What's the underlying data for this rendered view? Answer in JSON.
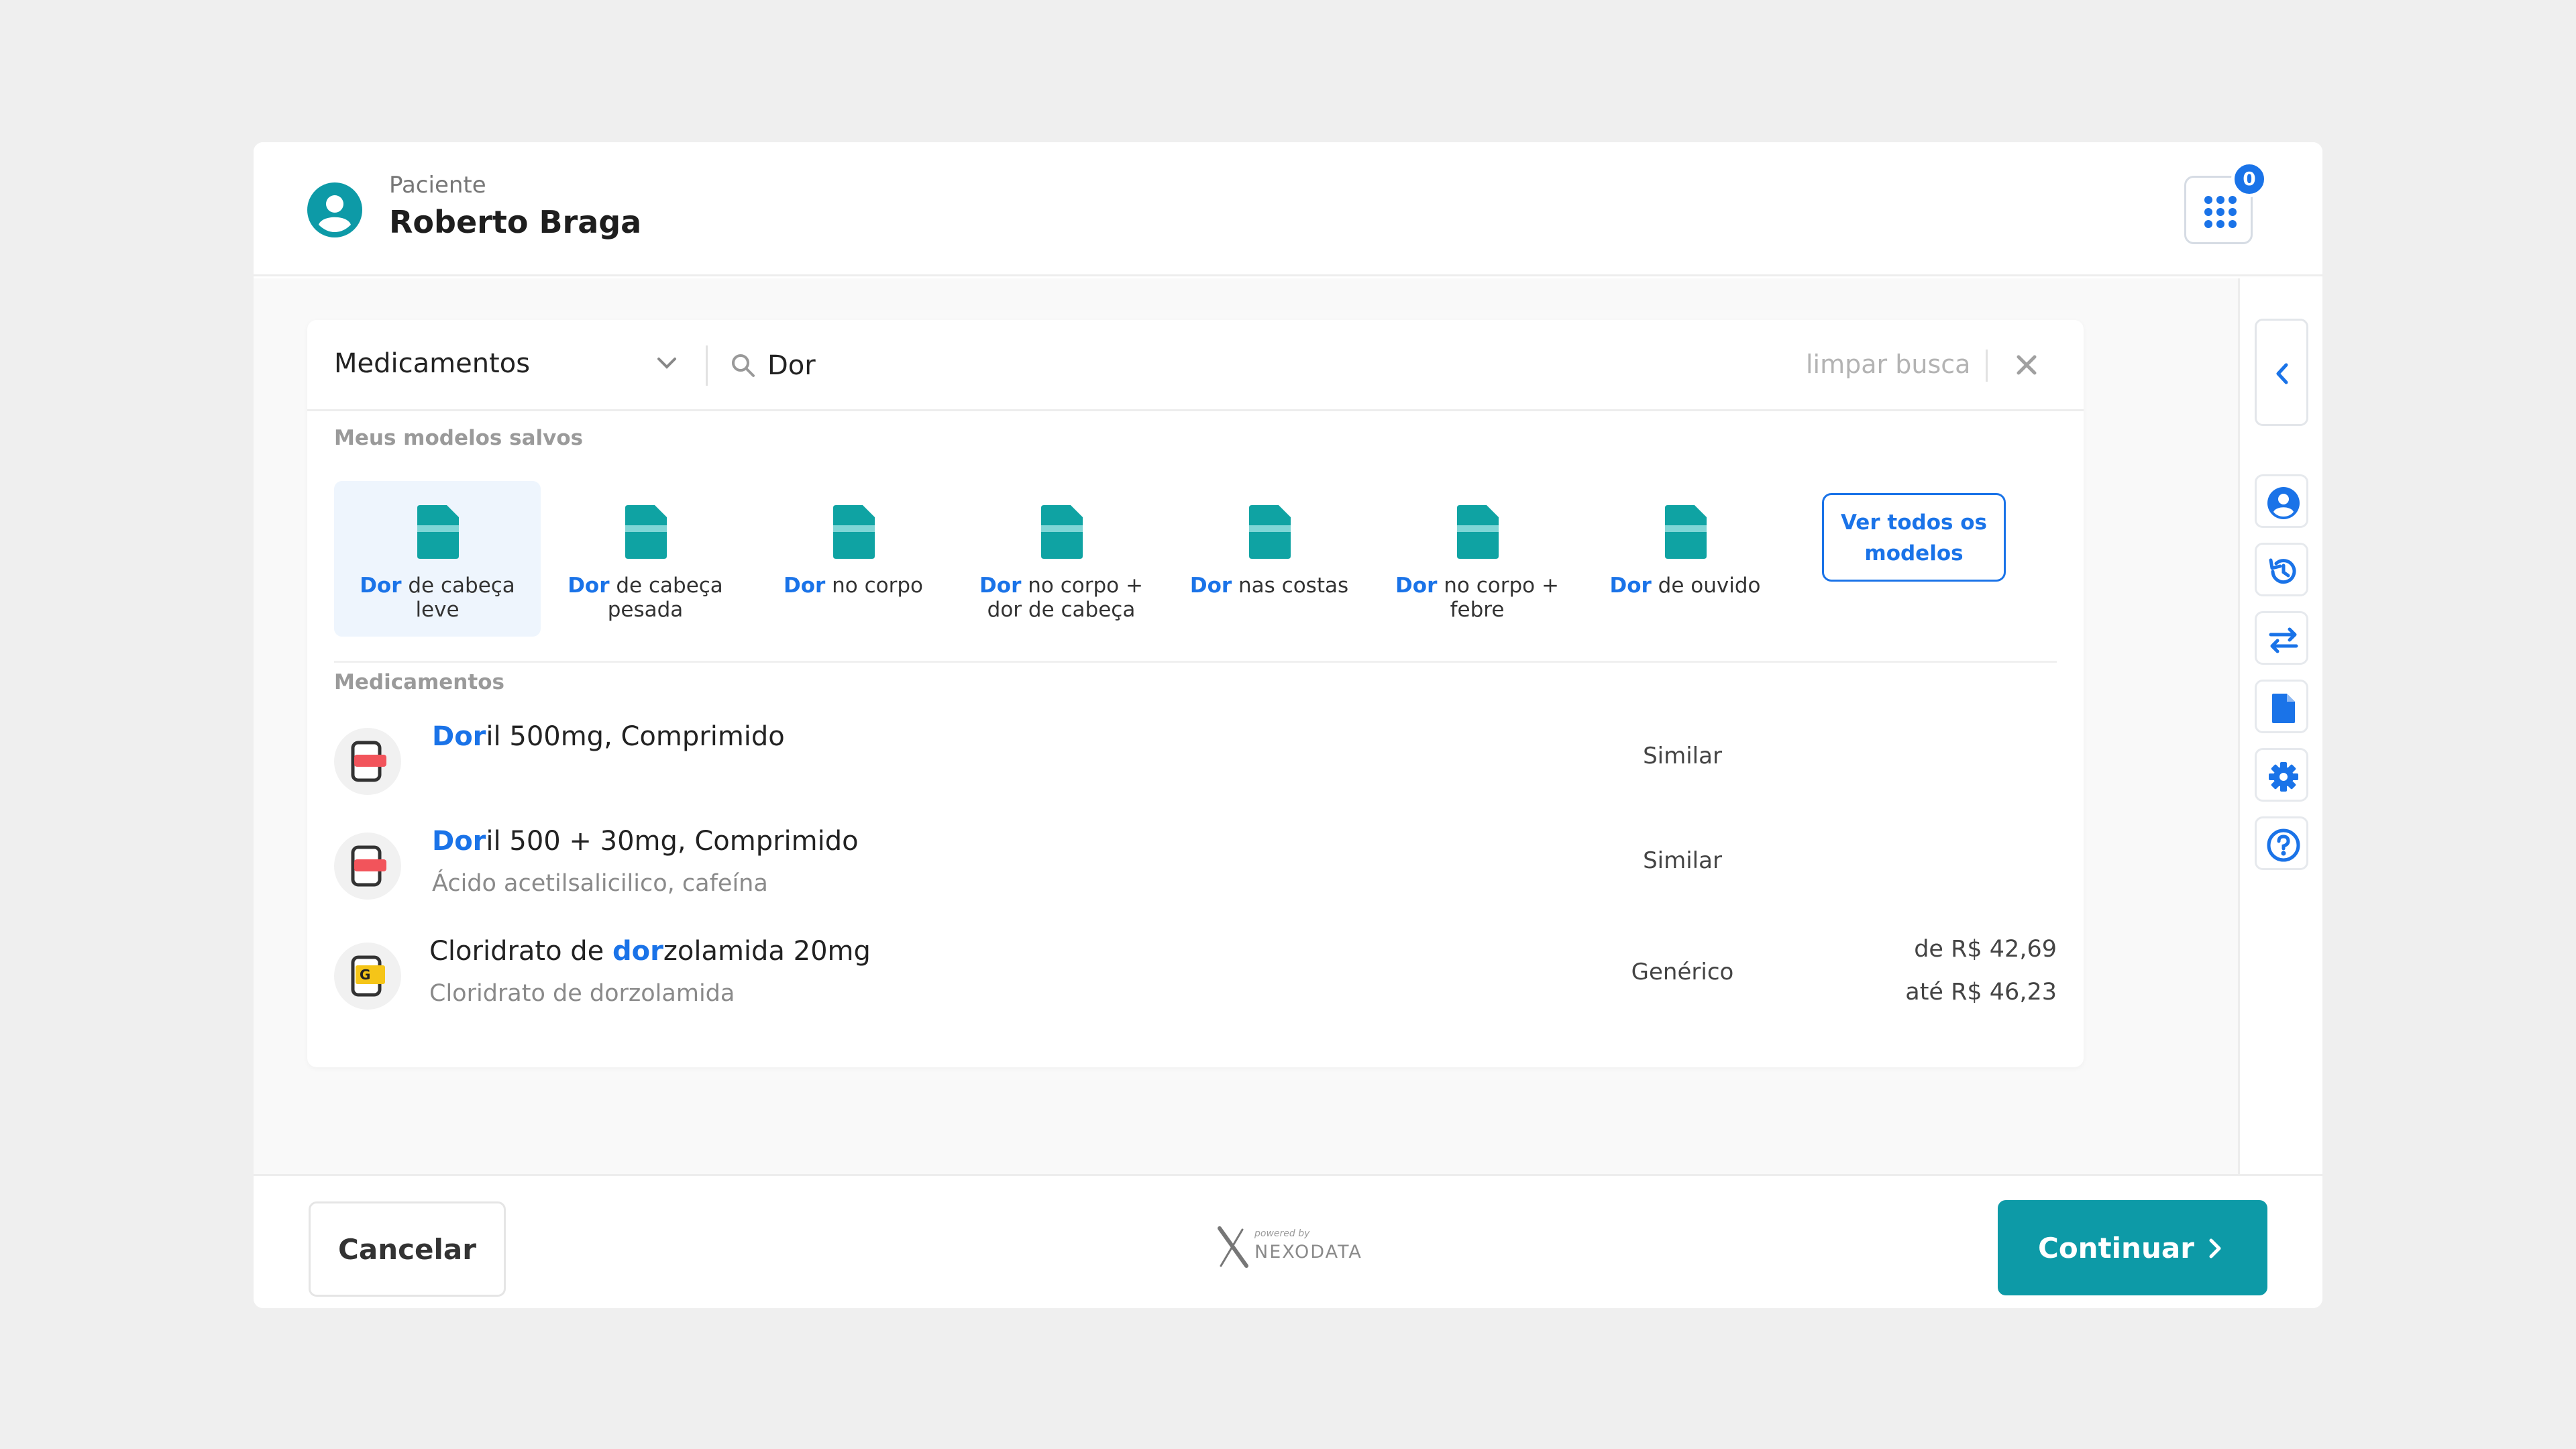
{
  "header": {
    "patient_label": "Paciente",
    "patient_name": "Roberto Braga",
    "apps_badge": "0"
  },
  "search": {
    "category": "Medicamentos",
    "query": "Dor",
    "clear_label": "limpar busca"
  },
  "templates": {
    "section_label": "Meus modelos salvos",
    "items": [
      {
        "highlight": "Dor",
        "line1": " de cabeça",
        "line2": "leve"
      },
      {
        "highlight": "Dor",
        "line1": " de cabeça",
        "line2": "pesada"
      },
      {
        "highlight": "Dor",
        "line1": " no corpo",
        "line2": ""
      },
      {
        "highlight": "Dor",
        "line1": " no corpo +",
        "line2": "dor de cabeça"
      },
      {
        "highlight": "Dor",
        "line1": " nas costas",
        "line2": ""
      },
      {
        "highlight": "Dor",
        "line1": " no corpo +",
        "line2": "febre"
      },
      {
        "highlight": "Dor",
        "line1": " de ouvido",
        "line2": ""
      }
    ],
    "see_all_line1": "Ver todos os",
    "see_all_line2": "modelos"
  },
  "medications": {
    "section_label": "Medicamentos",
    "items": [
      {
        "pre": "",
        "hl": "Dor",
        "post": "il 500mg, Comprimido",
        "sub": "",
        "type": "Similar",
        "price_from": "",
        "price_to": ""
      },
      {
        "pre": "",
        "hl": "Dor",
        "post": "il 500 + 30mg, Comprimido",
        "sub": "Ácido acetilsalicilico, cafeína",
        "type": "Similar",
        "price_from": "",
        "price_to": ""
      },
      {
        "pre": "Cloridrato de ",
        "hl": "dor",
        "post": "zolamida 20mg",
        "sub": "Cloridrato de dorzolamida",
        "type": "Genérico",
        "price_from": "de R$ 42,69",
        "price_to": "até R$ 46,23"
      }
    ]
  },
  "footer": {
    "cancel": "Cancelar",
    "logo_small": "powered by",
    "logo_text": "NEXODATA",
    "continue": "Continuar"
  },
  "colors": {
    "accent_blue": "#1a73e8",
    "primary_teal": "#0d9aa7",
    "template_icon": "#0fa3a3",
    "similar_pill": "#f2545b",
    "generic_badge": "#f5c518"
  }
}
